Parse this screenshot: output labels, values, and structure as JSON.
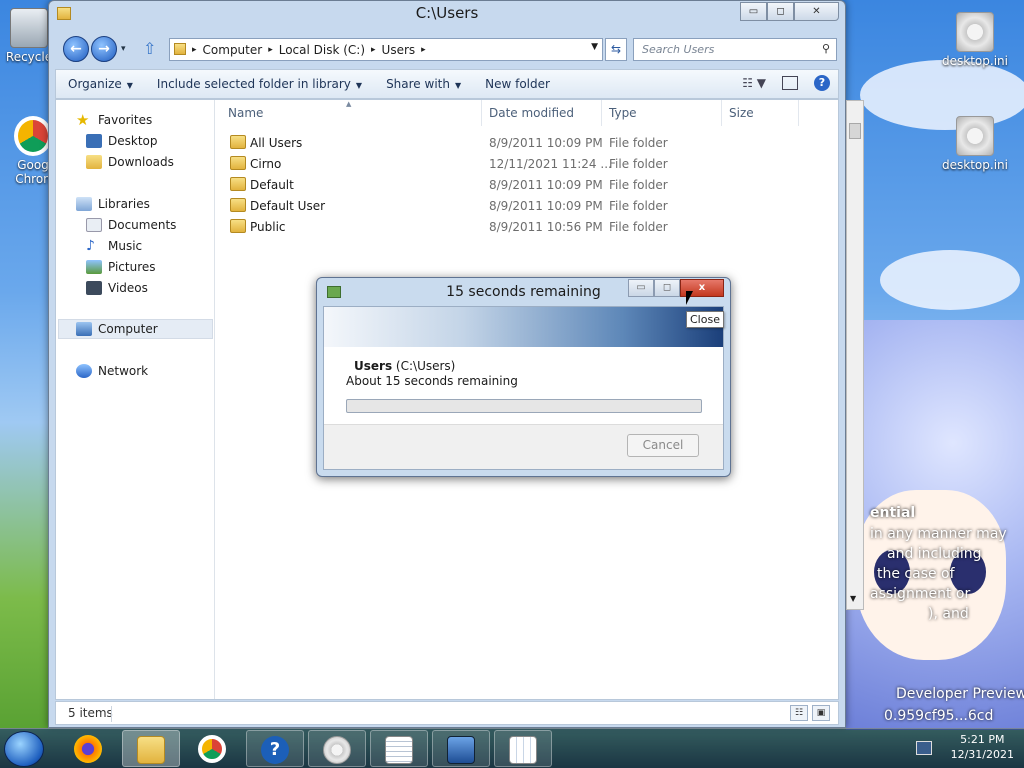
{
  "desktop": {
    "icons_left": [
      {
        "label": "Recycle",
        "icon": "recycle-bin-icon"
      },
      {
        "label": "Goog Chron",
        "icon": "chrome-icon"
      }
    ],
    "icons_right": [
      {
        "label": "desktop.ini",
        "icon": "settings-file-icon"
      },
      {
        "label": "desktop.ini",
        "icon": "settings-file-icon"
      }
    ],
    "overlay_text": [
      "ential",
      "in any manner may",
      "and including",
      "the case of",
      "assignment or",
      "), and",
      "Developer Preview",
      "0.959cf95...6cd"
    ]
  },
  "explorer": {
    "title": "C:\\Users",
    "caption": {
      "minimize": "▭",
      "maximize": "◻",
      "close": "✕"
    },
    "address": {
      "segments": [
        "Computer",
        "Local Disk (C:)",
        "Users"
      ],
      "sep": "▸"
    },
    "search_placeholder": "Search Users",
    "toolbar": {
      "organize": "Organize",
      "include": "Include selected folder in library",
      "share": "Share with",
      "new_folder": "New folder"
    },
    "nav": {
      "favorites": "Favorites",
      "desktop": "Desktop",
      "downloads": "Downloads",
      "libraries": "Libraries",
      "documents": "Documents",
      "music": "Music",
      "pictures": "Pictures",
      "videos": "Videos",
      "computer": "Computer",
      "network": "Network"
    },
    "columns": {
      "name": "Name",
      "date": "Date modified",
      "type": "Type",
      "size": "Size"
    },
    "files": [
      {
        "name": "All Users",
        "date": "8/9/2011 10:09 PM",
        "type": "File folder"
      },
      {
        "name": "Cirno",
        "date": "12/11/2021 11:24 ...",
        "type": "File folder"
      },
      {
        "name": "Default",
        "date": "8/9/2011 10:09 PM",
        "type": "File folder"
      },
      {
        "name": "Default User",
        "date": "8/9/2011 10:09 PM",
        "type": "File folder"
      },
      {
        "name": "Public",
        "date": "8/9/2011 10:56 PM",
        "type": "File folder"
      }
    ],
    "status": "5 items"
  },
  "dialog": {
    "title": "15 seconds remaining",
    "source_name": "Users",
    "source_path": "(C:\\Users)",
    "remaining": "About 15 seconds remaining",
    "progress": 0.0,
    "cancel": "Cancel",
    "close_glyph": "x"
  },
  "tooltip": "Close",
  "taskbar": {
    "time": "5:21 PM",
    "date": "12/31/2021",
    "apps": [
      "firefox-icon",
      "explorer-icon",
      "chrome-icon",
      "help-icon",
      "settings-icon",
      "notepad-icon",
      "network-icon",
      "calendar-icon"
    ]
  }
}
